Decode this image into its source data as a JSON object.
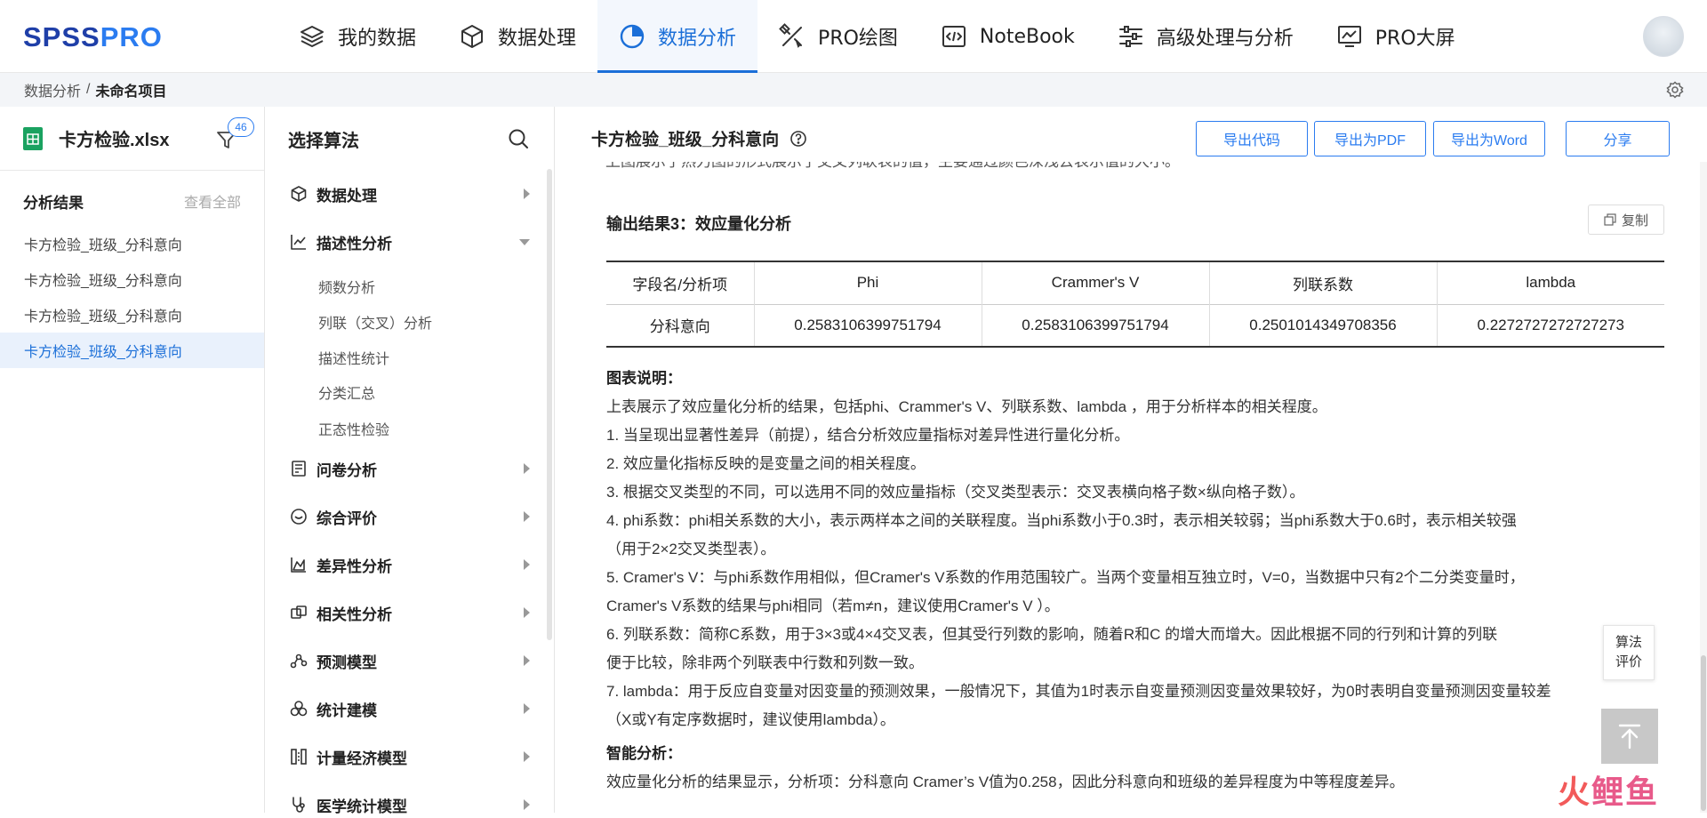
{
  "brand": {
    "logo_text_a": "SPSS",
    "logo_text_b": "PRO",
    "color_primary": "#1f3fa8",
    "color_accent": "#2b7cf0"
  },
  "nav": {
    "items": [
      {
        "label": "我的数据",
        "icon": "layers-icon",
        "active": false
      },
      {
        "label": "数据处理",
        "icon": "cube-icon",
        "active": false
      },
      {
        "label": "数据分析",
        "icon": "pie-chart-icon",
        "active": true
      },
      {
        "label": "PRO绘图",
        "icon": "drawing-tools-icon",
        "active": false
      },
      {
        "label": "NoteBook",
        "icon": "code-icon",
        "active": false
      },
      {
        "label": "高级处理与分析",
        "icon": "sliders-icon",
        "active": false
      },
      {
        "label": "PRO大屏",
        "icon": "dashboard-icon",
        "active": false
      }
    ]
  },
  "breadcrumb": {
    "parent": "数据分析",
    "separator": "/",
    "current": "未命名项目"
  },
  "file": {
    "name": "卡方检验.xlsx",
    "filter_count": "46"
  },
  "results": {
    "title": "分析结果",
    "view_all": "查看全部",
    "items": [
      "卡方检验_班级_分科意向",
      "卡方检验_班级_分科意向",
      "卡方检验_班级_分科意向",
      "卡方检验_班级_分科意向"
    ],
    "active_index": 3
  },
  "algorithms": {
    "title": "选择算法",
    "categories": [
      {
        "label": "数据处理",
        "icon": "cube-icon",
        "expanded": false
      },
      {
        "label": "描述性分析",
        "icon": "line-chart-icon",
        "expanded": true,
        "children": [
          "频数分析",
          "列联（交叉）分析",
          "描述性统计",
          "分类汇总",
          "正态性检验"
        ]
      },
      {
        "label": "问卷分析",
        "icon": "survey-icon",
        "expanded": false
      },
      {
        "label": "综合评价",
        "icon": "chat-icon",
        "expanded": false
      },
      {
        "label": "差异性分析",
        "icon": "area-chart-icon",
        "expanded": false
      },
      {
        "label": "相关性分析",
        "icon": "link-icon",
        "expanded": false
      },
      {
        "label": "预测模型",
        "icon": "nodes-icon",
        "expanded": false
      },
      {
        "label": "统计建模",
        "icon": "circles-icon",
        "expanded": false
      },
      {
        "label": "计量经济模型",
        "icon": "columns-icon",
        "expanded": false
      },
      {
        "label": "医学统计模型",
        "icon": "stethoscope-icon",
        "expanded": false
      }
    ]
  },
  "main": {
    "title": "卡方检验_班级_分科意向",
    "buttons": [
      "导出代码",
      "导出为PDF",
      "导出为Word",
      "分享"
    ],
    "cut_line": "上图展示了热力图的形式展示了交叉列联表的值，主要通过颜色深浅去表示值的大小。",
    "output_title": "输出结果3：效应量化分析",
    "copy_label": "复制",
    "table": {
      "headers": [
        "字段名/分析项",
        "Phi",
        "Crammer's V",
        "列联系数",
        "lambda"
      ],
      "rows": [
        [
          "分科意向",
          "0.2583106399751794",
          "0.2583106399751794",
          "0.2501014349708356",
          "0.2272727272727273"
        ]
      ]
    },
    "chart_note_title": "图表说明：",
    "chart_note_lines": [
      "上表展示了效应量化分析的结果，包括phi、Crammer's V、列联系数、lambda ，用于分析样本的相关程度。",
      "1. 当呈现出显著性差异（前提），结合分析效应量指标对差异性进行量化分析。",
      "2. 效应量化指标反映的是变量之间的相关程度。",
      "3. 根据交叉类型的不同，可以选用不同的效应量指标（交叉类型表示：交叉表横向格子数×纵向格子数）。",
      "4. phi系数：phi相关系数的大小，表示两样本之间的关联程度。当phi系数小于0.3时，表示相关较弱；当phi系数大于0.6时，表示相关较强",
      "（用于2×2交叉类型表）。",
      "5. Cramer's V：与phi系数作用相似，但Cramer's V系数的作用范围较广。当两个变量相互独立时，V=0，当数据中只有2个二分类变量时，",
      "Cramer's V系数的结果与phi相同（若m≠n，建议使用Cramer's V ）。",
      "6. 列联系数：简称C系数，用于3×3或4×4交叉表，但其受行列数的影响，随着R和C 的增大而增大。因此根据不同的行列和计算的列联",
      "便于比较，除非两个列联表中行数和列数一致。",
      "7. lambda：用于反应自变量对因变量的预测效果，一般情况下，其值为1时表示自变量预测因变量效果较好，为0时表明自变量预测因变量较差",
      "（X或Y有定序数据时，建议使用lambda）。"
    ],
    "smart_title": "智能分析：",
    "smart_text": "效应量化分析的结果显示，分析项：分科意向 Cramer’s V值为0.258，因此分科意向和班级的差异程度为中等程度差异。"
  },
  "float": {
    "rate_line1": "算法",
    "rate_line2": "评价"
  },
  "watermark": {
    "char1": "火",
    "char2": "鲤",
    "char3": "鱼"
  }
}
